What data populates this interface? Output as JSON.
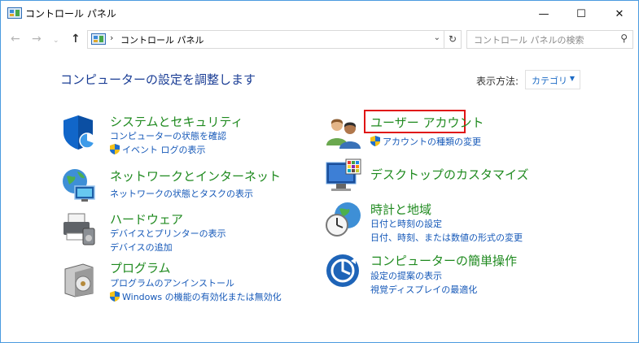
{
  "window": {
    "title": "コントロール パネル",
    "controls": {
      "minimize": "—",
      "maximize": "☐",
      "close": "✕"
    }
  },
  "nav": {
    "back": "←",
    "forward": "→",
    "history": "⌄",
    "up": "↑"
  },
  "address": {
    "separator": "›",
    "path": "コントロール パネル",
    "dropdown": "⌄",
    "refresh": "↻"
  },
  "search": {
    "placeholder": "コントロール パネルの検索",
    "icon": "⚲"
  },
  "main": {
    "heading": "コンピューターの設定を調整します",
    "view_by_label": "表示方法:",
    "view_by_value": "カテゴリ",
    "view_by_arrow": "▼"
  },
  "categories": {
    "system_security": {
      "title": "システムとセキュリティ",
      "links": [
        "コンピューターの状態を確認",
        "イベント ログの表示"
      ]
    },
    "network": {
      "title": "ネットワークとインターネット",
      "links": [
        "ネットワークの状態とタスクの表示"
      ]
    },
    "hardware": {
      "title": "ハードウェア",
      "links": [
        "デバイスとプリンターの表示",
        "デバイスの追加"
      ]
    },
    "programs": {
      "title": "プログラム",
      "links": [
        "プログラムのアンインストール",
        "Windows の機能の有効化または無効化"
      ]
    },
    "user_accounts": {
      "title": "ユーザー アカウント",
      "links": [
        "アカウントの種類の変更"
      ]
    },
    "appearance": {
      "title": "デスクトップのカスタマイズ",
      "links": []
    },
    "clock_region": {
      "title": "時計と地域",
      "links": [
        "日付と時刻の設定",
        "日付、時刻、または数値の形式の変更"
      ]
    },
    "ease_of_access": {
      "title": "コンピューターの簡単操作",
      "links": [
        "設定の提案の表示",
        "視覚ディスプレイの最適化"
      ]
    }
  },
  "colors": {
    "category_title": "#1f8a1f",
    "link": "#1558b8",
    "heading": "#1a3d95",
    "highlight_border": "#e01414",
    "window_border": "#4a9be0"
  }
}
